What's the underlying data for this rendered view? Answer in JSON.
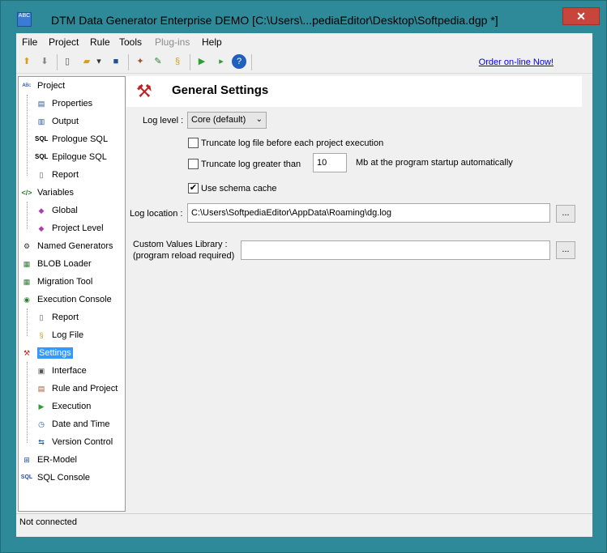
{
  "window": {
    "title": "DTM Data Generator Enterprise DEMO [C:\\Users\\...pediaEditor\\Desktop\\Softpedia.dgp *]",
    "app_icon_text": "ABC",
    "close_label": "✕"
  },
  "menu": {
    "items": [
      {
        "label": "File",
        "enabled": true
      },
      {
        "label": "Project",
        "enabled": true
      },
      {
        "label": "Rule",
        "enabled": true
      },
      {
        "label": "Tools",
        "enabled": true
      },
      {
        "label": "Plug-ins",
        "enabled": false
      },
      {
        "label": "Help",
        "enabled": true
      }
    ]
  },
  "toolbar": {
    "order_link": "Order on-line Now!"
  },
  "tree": {
    "items": [
      {
        "label": "Project",
        "icon": "project-icon"
      },
      {
        "label": "Properties",
        "icon": "properties-icon"
      },
      {
        "label": "Output",
        "icon": "output-icon"
      },
      {
        "label": "Prologue SQL",
        "icon": "sql-icon"
      },
      {
        "label": "Epilogue SQL",
        "icon": "sql-icon"
      },
      {
        "label": "Report",
        "icon": "report-icon"
      },
      {
        "label": "Variables",
        "icon": "variables-icon"
      },
      {
        "label": "Global",
        "icon": "global-icon"
      },
      {
        "label": "Project Level",
        "icon": "project-level-icon"
      },
      {
        "label": "Named Generators",
        "icon": "named-generators-icon"
      },
      {
        "label": "BLOB Loader",
        "icon": "blob-loader-icon"
      },
      {
        "label": "Migration Tool",
        "icon": "migration-tool-icon"
      },
      {
        "label": "Execution Console",
        "icon": "execution-console-icon"
      },
      {
        "label": "Report",
        "icon": "report-icon"
      },
      {
        "label": "Log File",
        "icon": "log-file-icon"
      },
      {
        "label": "Settings",
        "icon": "settings-icon"
      },
      {
        "label": "Interface",
        "icon": "interface-icon"
      },
      {
        "label": "Rule and Project",
        "icon": "rule-project-icon"
      },
      {
        "label": "Execution",
        "icon": "execution-icon"
      },
      {
        "label": "Date and Time",
        "icon": "clock-icon"
      },
      {
        "label": "Version Control",
        "icon": "version-control-icon"
      },
      {
        "label": "ER-Model",
        "icon": "er-model-icon"
      },
      {
        "label": "SQL Console",
        "icon": "sql-console-icon"
      }
    ]
  },
  "settings": {
    "title": "General Settings",
    "log_level_label": "Log level :",
    "log_level_value": "Core (default)",
    "truncate_each_label": "Truncate log file before each project execution",
    "truncate_greater_label": "Truncate log greater than",
    "truncate_size_value": "10",
    "truncate_unit_label": "Mb at the program startup automatically",
    "schema_cache_label": "Use schema cache",
    "log_location_label": "Log location :",
    "log_location_value": "C:\\Users\\SoftpediaEditor\\AppData\\Roaming\\dg.log",
    "custom_values_label_1": "Custom Values Library :",
    "custom_values_label_2": "(program reload required)",
    "custom_values_value": "",
    "browse_label": "...",
    "truncate_each_checked": false,
    "truncate_greater_checked": false,
    "schema_cache_checked": true
  },
  "status": {
    "text": "Not connected"
  }
}
